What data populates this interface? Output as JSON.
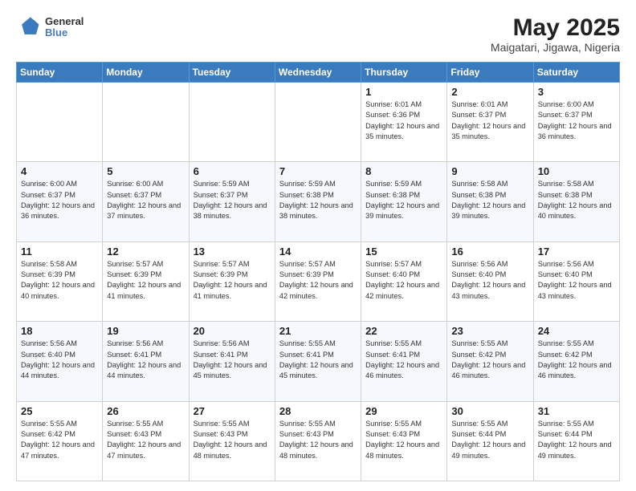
{
  "header": {
    "logo_line1": "General",
    "logo_line2": "Blue",
    "title": "May 2025",
    "subtitle": "Maigatari, Jigawa, Nigeria"
  },
  "days_of_week": [
    "Sunday",
    "Monday",
    "Tuesday",
    "Wednesday",
    "Thursday",
    "Friday",
    "Saturday"
  ],
  "weeks": [
    [
      {
        "day": "",
        "content": ""
      },
      {
        "day": "",
        "content": ""
      },
      {
        "day": "",
        "content": ""
      },
      {
        "day": "",
        "content": ""
      },
      {
        "day": "1",
        "content": "Sunrise: 6:01 AM\nSunset: 6:36 PM\nDaylight: 12 hours\nand 35 minutes."
      },
      {
        "day": "2",
        "content": "Sunrise: 6:01 AM\nSunset: 6:37 PM\nDaylight: 12 hours\nand 35 minutes."
      },
      {
        "day": "3",
        "content": "Sunrise: 6:00 AM\nSunset: 6:37 PM\nDaylight: 12 hours\nand 36 minutes."
      }
    ],
    [
      {
        "day": "4",
        "content": "Sunrise: 6:00 AM\nSunset: 6:37 PM\nDaylight: 12 hours\nand 36 minutes."
      },
      {
        "day": "5",
        "content": "Sunrise: 6:00 AM\nSunset: 6:37 PM\nDaylight: 12 hours\nand 37 minutes."
      },
      {
        "day": "6",
        "content": "Sunrise: 5:59 AM\nSunset: 6:37 PM\nDaylight: 12 hours\nand 38 minutes."
      },
      {
        "day": "7",
        "content": "Sunrise: 5:59 AM\nSunset: 6:38 PM\nDaylight: 12 hours\nand 38 minutes."
      },
      {
        "day": "8",
        "content": "Sunrise: 5:59 AM\nSunset: 6:38 PM\nDaylight: 12 hours\nand 39 minutes."
      },
      {
        "day": "9",
        "content": "Sunrise: 5:58 AM\nSunset: 6:38 PM\nDaylight: 12 hours\nand 39 minutes."
      },
      {
        "day": "10",
        "content": "Sunrise: 5:58 AM\nSunset: 6:38 PM\nDaylight: 12 hours\nand 40 minutes."
      }
    ],
    [
      {
        "day": "11",
        "content": "Sunrise: 5:58 AM\nSunset: 6:39 PM\nDaylight: 12 hours\nand 40 minutes."
      },
      {
        "day": "12",
        "content": "Sunrise: 5:57 AM\nSunset: 6:39 PM\nDaylight: 12 hours\nand 41 minutes."
      },
      {
        "day": "13",
        "content": "Sunrise: 5:57 AM\nSunset: 6:39 PM\nDaylight: 12 hours\nand 41 minutes."
      },
      {
        "day": "14",
        "content": "Sunrise: 5:57 AM\nSunset: 6:39 PM\nDaylight: 12 hours\nand 42 minutes."
      },
      {
        "day": "15",
        "content": "Sunrise: 5:57 AM\nSunset: 6:40 PM\nDaylight: 12 hours\nand 42 minutes."
      },
      {
        "day": "16",
        "content": "Sunrise: 5:56 AM\nSunset: 6:40 PM\nDaylight: 12 hours\nand 43 minutes."
      },
      {
        "day": "17",
        "content": "Sunrise: 5:56 AM\nSunset: 6:40 PM\nDaylight: 12 hours\nand 43 minutes."
      }
    ],
    [
      {
        "day": "18",
        "content": "Sunrise: 5:56 AM\nSunset: 6:40 PM\nDaylight: 12 hours\nand 44 minutes."
      },
      {
        "day": "19",
        "content": "Sunrise: 5:56 AM\nSunset: 6:41 PM\nDaylight: 12 hours\nand 44 minutes."
      },
      {
        "day": "20",
        "content": "Sunrise: 5:56 AM\nSunset: 6:41 PM\nDaylight: 12 hours\nand 45 minutes."
      },
      {
        "day": "21",
        "content": "Sunrise: 5:55 AM\nSunset: 6:41 PM\nDaylight: 12 hours\nand 45 minutes."
      },
      {
        "day": "22",
        "content": "Sunrise: 5:55 AM\nSunset: 6:41 PM\nDaylight: 12 hours\nand 46 minutes."
      },
      {
        "day": "23",
        "content": "Sunrise: 5:55 AM\nSunset: 6:42 PM\nDaylight: 12 hours\nand 46 minutes."
      },
      {
        "day": "24",
        "content": "Sunrise: 5:55 AM\nSunset: 6:42 PM\nDaylight: 12 hours\nand 46 minutes."
      }
    ],
    [
      {
        "day": "25",
        "content": "Sunrise: 5:55 AM\nSunset: 6:42 PM\nDaylight: 12 hours\nand 47 minutes."
      },
      {
        "day": "26",
        "content": "Sunrise: 5:55 AM\nSunset: 6:43 PM\nDaylight: 12 hours\nand 47 minutes."
      },
      {
        "day": "27",
        "content": "Sunrise: 5:55 AM\nSunset: 6:43 PM\nDaylight: 12 hours\nand 48 minutes."
      },
      {
        "day": "28",
        "content": "Sunrise: 5:55 AM\nSunset: 6:43 PM\nDaylight: 12 hours\nand 48 minutes."
      },
      {
        "day": "29",
        "content": "Sunrise: 5:55 AM\nSunset: 6:43 PM\nDaylight: 12 hours\nand 48 minutes."
      },
      {
        "day": "30",
        "content": "Sunrise: 5:55 AM\nSunset: 6:44 PM\nDaylight: 12 hours\nand 49 minutes."
      },
      {
        "day": "31",
        "content": "Sunrise: 5:55 AM\nSunset: 6:44 PM\nDaylight: 12 hours\nand 49 minutes."
      }
    ]
  ]
}
